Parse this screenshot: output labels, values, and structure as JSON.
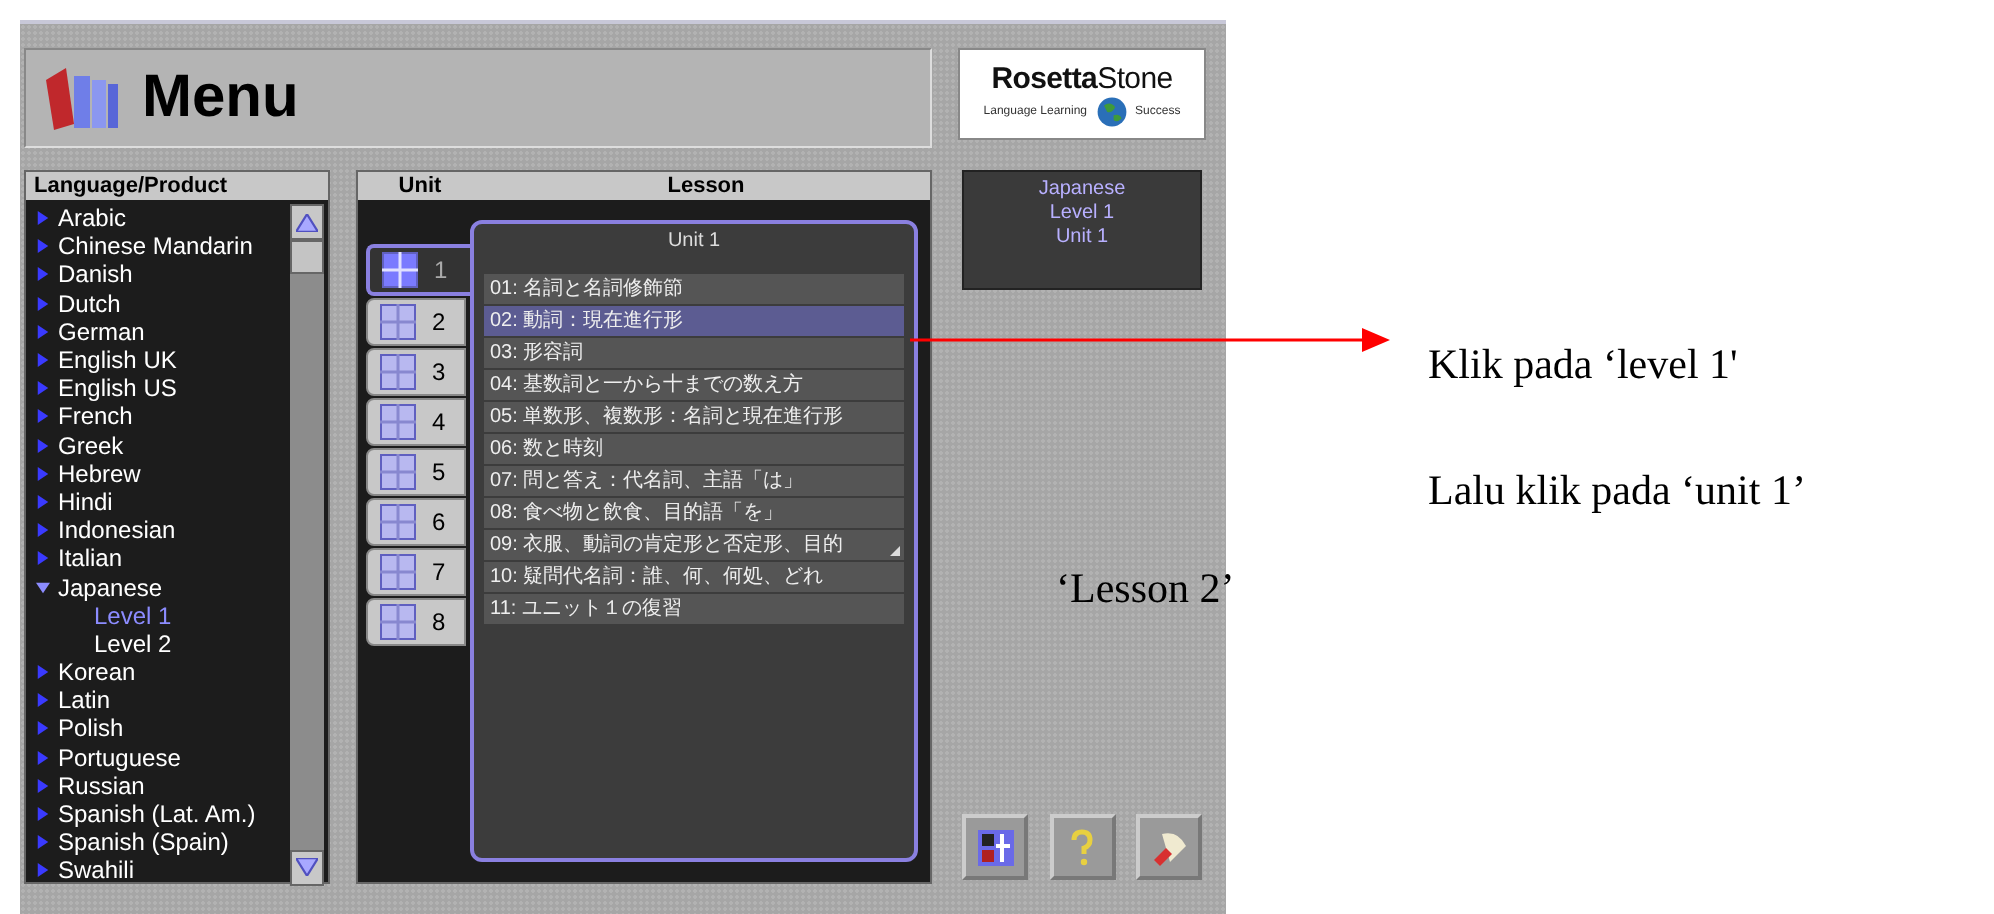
{
  "title_bar": {
    "title": "Menu"
  },
  "logo": {
    "name": "**Rosetta**Stone",
    "left_tagline": "Language Learning",
    "right_tagline": "Success"
  },
  "language_panel": {
    "header": "Language/Product",
    "items": [
      {
        "label": "Arabic",
        "expanded": false
      },
      {
        "label": "Chinese Mandarin",
        "expanded": false
      },
      {
        "label": "Danish",
        "expanded": false
      },
      {
        "label": "Dutch",
        "expanded": false
      },
      {
        "label": "German",
        "expanded": false
      },
      {
        "label": "English UK",
        "expanded": false
      },
      {
        "label": "English US",
        "expanded": false
      },
      {
        "label": "French",
        "expanded": false
      },
      {
        "label": "Greek",
        "expanded": false
      },
      {
        "label": "Hebrew",
        "expanded": false
      },
      {
        "label": "Hindi",
        "expanded": false
      },
      {
        "label": "Indonesian",
        "expanded": false
      },
      {
        "label": "Italian",
        "expanded": false
      },
      {
        "label": "Japanese",
        "expanded": true,
        "children": [
          {
            "label": "Level 1",
            "selected": true
          },
          {
            "label": "Level 2",
            "selected": false
          }
        ]
      },
      {
        "label": "Korean",
        "expanded": false
      },
      {
        "label": "Latin",
        "expanded": false
      },
      {
        "label": "Polish",
        "expanded": false
      },
      {
        "label": "Portuguese",
        "expanded": false
      },
      {
        "label": "Russian",
        "expanded": false
      },
      {
        "label": "Spanish (Lat. Am.)",
        "expanded": false
      },
      {
        "label": "Spanish (Spain)",
        "expanded": false
      },
      {
        "label": "Swahili",
        "expanded": false
      }
    ]
  },
  "lesson_panel": {
    "unit_header": "Unit",
    "lesson_header": "Lesson",
    "units": [
      {
        "label": "1",
        "selected": true
      },
      {
        "label": "2",
        "selected": false
      },
      {
        "label": "3",
        "selected": false
      },
      {
        "label": "4",
        "selected": false
      },
      {
        "label": "5",
        "selected": false
      },
      {
        "label": "6",
        "selected": false
      },
      {
        "label": "7",
        "selected": false
      },
      {
        "label": "8",
        "selected": false
      }
    ],
    "unit_title": "Unit 1",
    "lessons": [
      {
        "label": "01: 名詞と名詞修飾節",
        "selected": false,
        "truncated": false
      },
      {
        "label": "02: 動詞：現在進行形",
        "selected": true,
        "truncated": false
      },
      {
        "label": "03: 形容詞",
        "selected": false,
        "truncated": false
      },
      {
        "label": "04: 基数詞と一から十までの数え方",
        "selected": false,
        "truncated": false
      },
      {
        "label": "05: 単数形、複数形：名詞と現在進行形",
        "selected": false,
        "truncated": false
      },
      {
        "label": "06: 数と時刻",
        "selected": false,
        "truncated": false
      },
      {
        "label": "07: 問と答え：代名詞、主語「は」",
        "selected": false,
        "truncated": false
      },
      {
        "label": "08: 食べ物と飲食、目的語「を」",
        "selected": false,
        "truncated": false
      },
      {
        "label": "09: 衣服、動詞の肯定形と否定形、目的",
        "selected": false,
        "truncated": true
      },
      {
        "label": "10: 疑問代名詞：誰、何、何処、どれ",
        "selected": false,
        "truncated": false
      },
      {
        "label": "11: ユニット１の復習",
        "selected": false,
        "truncated": false
      }
    ]
  },
  "current_selection": [
    "Japanese",
    "Level 1",
    "Unit 1"
  ],
  "tool_buttons": [
    {
      "kind": "settings"
    },
    {
      "kind": "help"
    },
    {
      "kind": "exit"
    }
  ],
  "annotations": [
    "Klik pada ‘level 1'",
    "Lalu klik pada ‘unit 1’",
    "‘Lesson 2’"
  ]
}
